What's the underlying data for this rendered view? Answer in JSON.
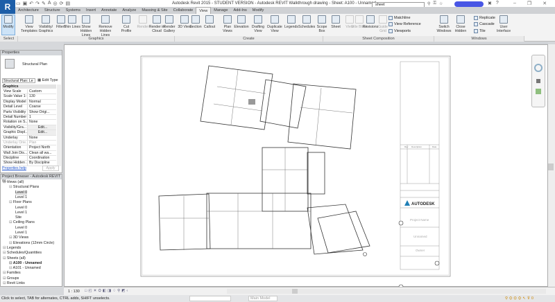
{
  "app": {
    "logo": "R",
    "title": "Autodesk Revit 2015 - STUDENT VERSION -    Autodesk REVIT Walkthrough drawing - Sheet: A100 - Unnamed",
    "search_value": "sheet"
  },
  "tabs": [
    "Architecture",
    "Structure",
    "Systems",
    "Insert",
    "Annotate",
    "Analyze",
    "Massing & Site",
    "Collaborate",
    "View",
    "Manage",
    "Add-Ins",
    "Modify"
  ],
  "active_tab": "View",
  "ribbon": {
    "buttons": [
      {
        "label": "Modify",
        "icon": "cursor-icon"
      },
      {
        "label": "View Templates",
        "icon": "view-templates-icon"
      },
      {
        "label": "Visibility/ Graphics",
        "icon": "visibility-icon"
      },
      {
        "label": "Filters",
        "icon": "filters-icon"
      },
      {
        "label": "Thin Lines",
        "icon": "thin-lines-icon"
      },
      {
        "label": "Show Hidden Lines",
        "icon": "show-hidden-icon"
      },
      {
        "label": "Remove Hidden Lines",
        "icon": "remove-hidden-icon"
      },
      {
        "label": "Cut Profile",
        "icon": "cut-profile-icon"
      },
      {
        "label": "Render",
        "icon": "render-icon",
        "disabled": true
      },
      {
        "label": "Render in Cloud",
        "icon": "cloud-icon"
      },
      {
        "label": "Render Gallery",
        "icon": "gallery-icon"
      },
      {
        "label": "3D View",
        "icon": "3d-view-icon"
      },
      {
        "label": "Section",
        "icon": "section-icon"
      },
      {
        "label": "Callout",
        "icon": "callout-icon"
      },
      {
        "label": "Plan Views",
        "icon": "plan-views-icon"
      },
      {
        "label": "Elevation",
        "icon": "elevation-icon"
      },
      {
        "label": "Drafting View",
        "icon": "drafting-icon"
      },
      {
        "label": "Duplicate View",
        "icon": "duplicate-icon"
      },
      {
        "label": "Legends",
        "icon": "legends-icon"
      },
      {
        "label": "Schedules",
        "icon": "schedules-icon"
      },
      {
        "label": "Scope Box",
        "icon": "scope-box-icon"
      },
      {
        "label": "Sheet",
        "icon": "sheet-icon"
      },
      {
        "label": "View",
        "icon": "view-icon",
        "disabled": true
      },
      {
        "label": "Title Block",
        "icon": "title-block-icon",
        "disabled": true
      },
      {
        "label": "Revisions",
        "icon": "revisions-icon"
      },
      {
        "label": "Guide Grid",
        "icon": "guide-grid-icon",
        "disabled": true
      },
      {
        "label": "Switch Windows",
        "icon": "switch-windows-icon"
      },
      {
        "label": "Close Hidden",
        "icon": "close-hidden-icon"
      },
      {
        "label": "User Interface",
        "icon": "user-interface-icon"
      }
    ],
    "small": [
      "Matchline",
      "View Reference",
      "Viewports",
      "Replicate",
      "Cascade",
      "Tile"
    ],
    "panels": [
      "Select",
      "Graphics",
      "Create",
      "Sheet Composition",
      "Windows"
    ]
  },
  "properties": {
    "header": "Properties",
    "type_name": "Structural Plan",
    "type_select": "Structural Plan: Le",
    "edit_type": "Edit Type",
    "group": "Graphics",
    "rows": [
      [
        "View Scale",
        "Custom"
      ],
      [
        "Scale Value    1:",
        "130"
      ],
      [
        "Display Model",
        "Normal"
      ],
      [
        "Detail Level",
        "Coarse"
      ],
      [
        "Parts Visibility",
        "Show Origi..."
      ],
      [
        "Detail Number",
        "1"
      ],
      [
        "Rotation on S...",
        "None"
      ],
      [
        "Visibility/Gra...",
        "Edit..."
      ],
      [
        "Graphic Displ...",
        "Edit..."
      ],
      [
        "Underlay",
        "None"
      ],
      [
        "Underlay Orie...",
        "Plan"
      ],
      [
        "Orientation",
        "Project North"
      ],
      [
        "Wall Join Dis...",
        "Clean all wa..."
      ],
      [
        "Discipline",
        "Coordination"
      ],
      [
        "Show Hidden ...",
        "By Discipline"
      ]
    ],
    "help": "Properties help",
    "apply": "Apply"
  },
  "browser": {
    "header": "Project Browser - Autodesk REVIT W...",
    "nodes": [
      {
        "label": "Views (all)",
        "level": 0
      },
      {
        "label": "Structural Plans",
        "level": 1
      },
      {
        "label": "Level 0",
        "level": 2,
        "selected": true
      },
      {
        "label": "Level 1",
        "level": 2
      },
      {
        "label": "Floor Plans",
        "level": 1
      },
      {
        "label": "Level 0",
        "level": 2
      },
      {
        "label": "Level 1",
        "level": 2
      },
      {
        "label": "Site",
        "level": 2
      },
      {
        "label": "Ceiling Plans",
        "level": 1
      },
      {
        "label": "Level 0",
        "level": 2
      },
      {
        "label": "Level 1",
        "level": 2
      },
      {
        "label": "3D Views",
        "level": 1
      },
      {
        "label": "Elevations (12mm Circle)",
        "level": 1
      },
      {
        "label": "Legends",
        "level": 0
      },
      {
        "label": "Schedules/Quantities",
        "level": 0
      },
      {
        "label": "Sheets (all)",
        "level": 0
      },
      {
        "label": "A100 - Unnamed",
        "level": 1,
        "bold": true
      },
      {
        "label": "A101 - Unnamed",
        "level": 1
      },
      {
        "label": "Families",
        "level": 0
      },
      {
        "label": "Groups",
        "level": 0
      },
      {
        "label": "Revit Links",
        "level": 0
      }
    ]
  },
  "titleblock": {
    "company": "AUTODESK",
    "project": "Project Name",
    "sheet_name": "Unnamed",
    "owner": "Owner",
    "rev_headers": [
      "Rev",
      "Description",
      "Date"
    ]
  },
  "viewbar": {
    "scale": "1 : 130"
  },
  "status": {
    "hint": "Click to select, TAB for alternates, CTRL adds, SHIFT unselects.",
    "model": "Main Model"
  }
}
